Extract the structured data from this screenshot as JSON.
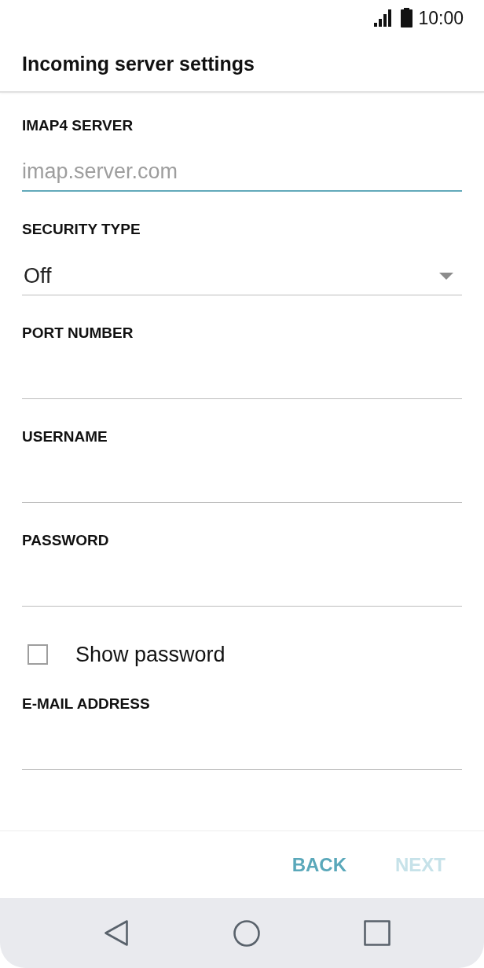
{
  "status_bar": {
    "time": "10:00"
  },
  "header": {
    "title": "Incoming server settings"
  },
  "fields": [
    {
      "kind": "text",
      "label": "IMAP4 SERVER",
      "placeholder": "imap.server.com",
      "focused": true
    },
    {
      "kind": "dropdown",
      "label": "SECURITY TYPE",
      "value": "Off",
      "focused": false
    },
    {
      "kind": "text",
      "label": "PORT NUMBER",
      "focused": false
    },
    {
      "kind": "text",
      "label": "USERNAME",
      "focused": false
    },
    {
      "kind": "text",
      "label": "PASSWORD",
      "focused": false
    },
    {
      "kind": "checkbox",
      "label": "Show password",
      "checked": false
    },
    {
      "kind": "text",
      "label": "E-MAIL ADDRESS",
      "focused": false
    }
  ],
  "buttons": [
    {
      "label": "BACK",
      "disabled": false
    },
    {
      "label": "NEXT",
      "disabled": true
    }
  ]
}
